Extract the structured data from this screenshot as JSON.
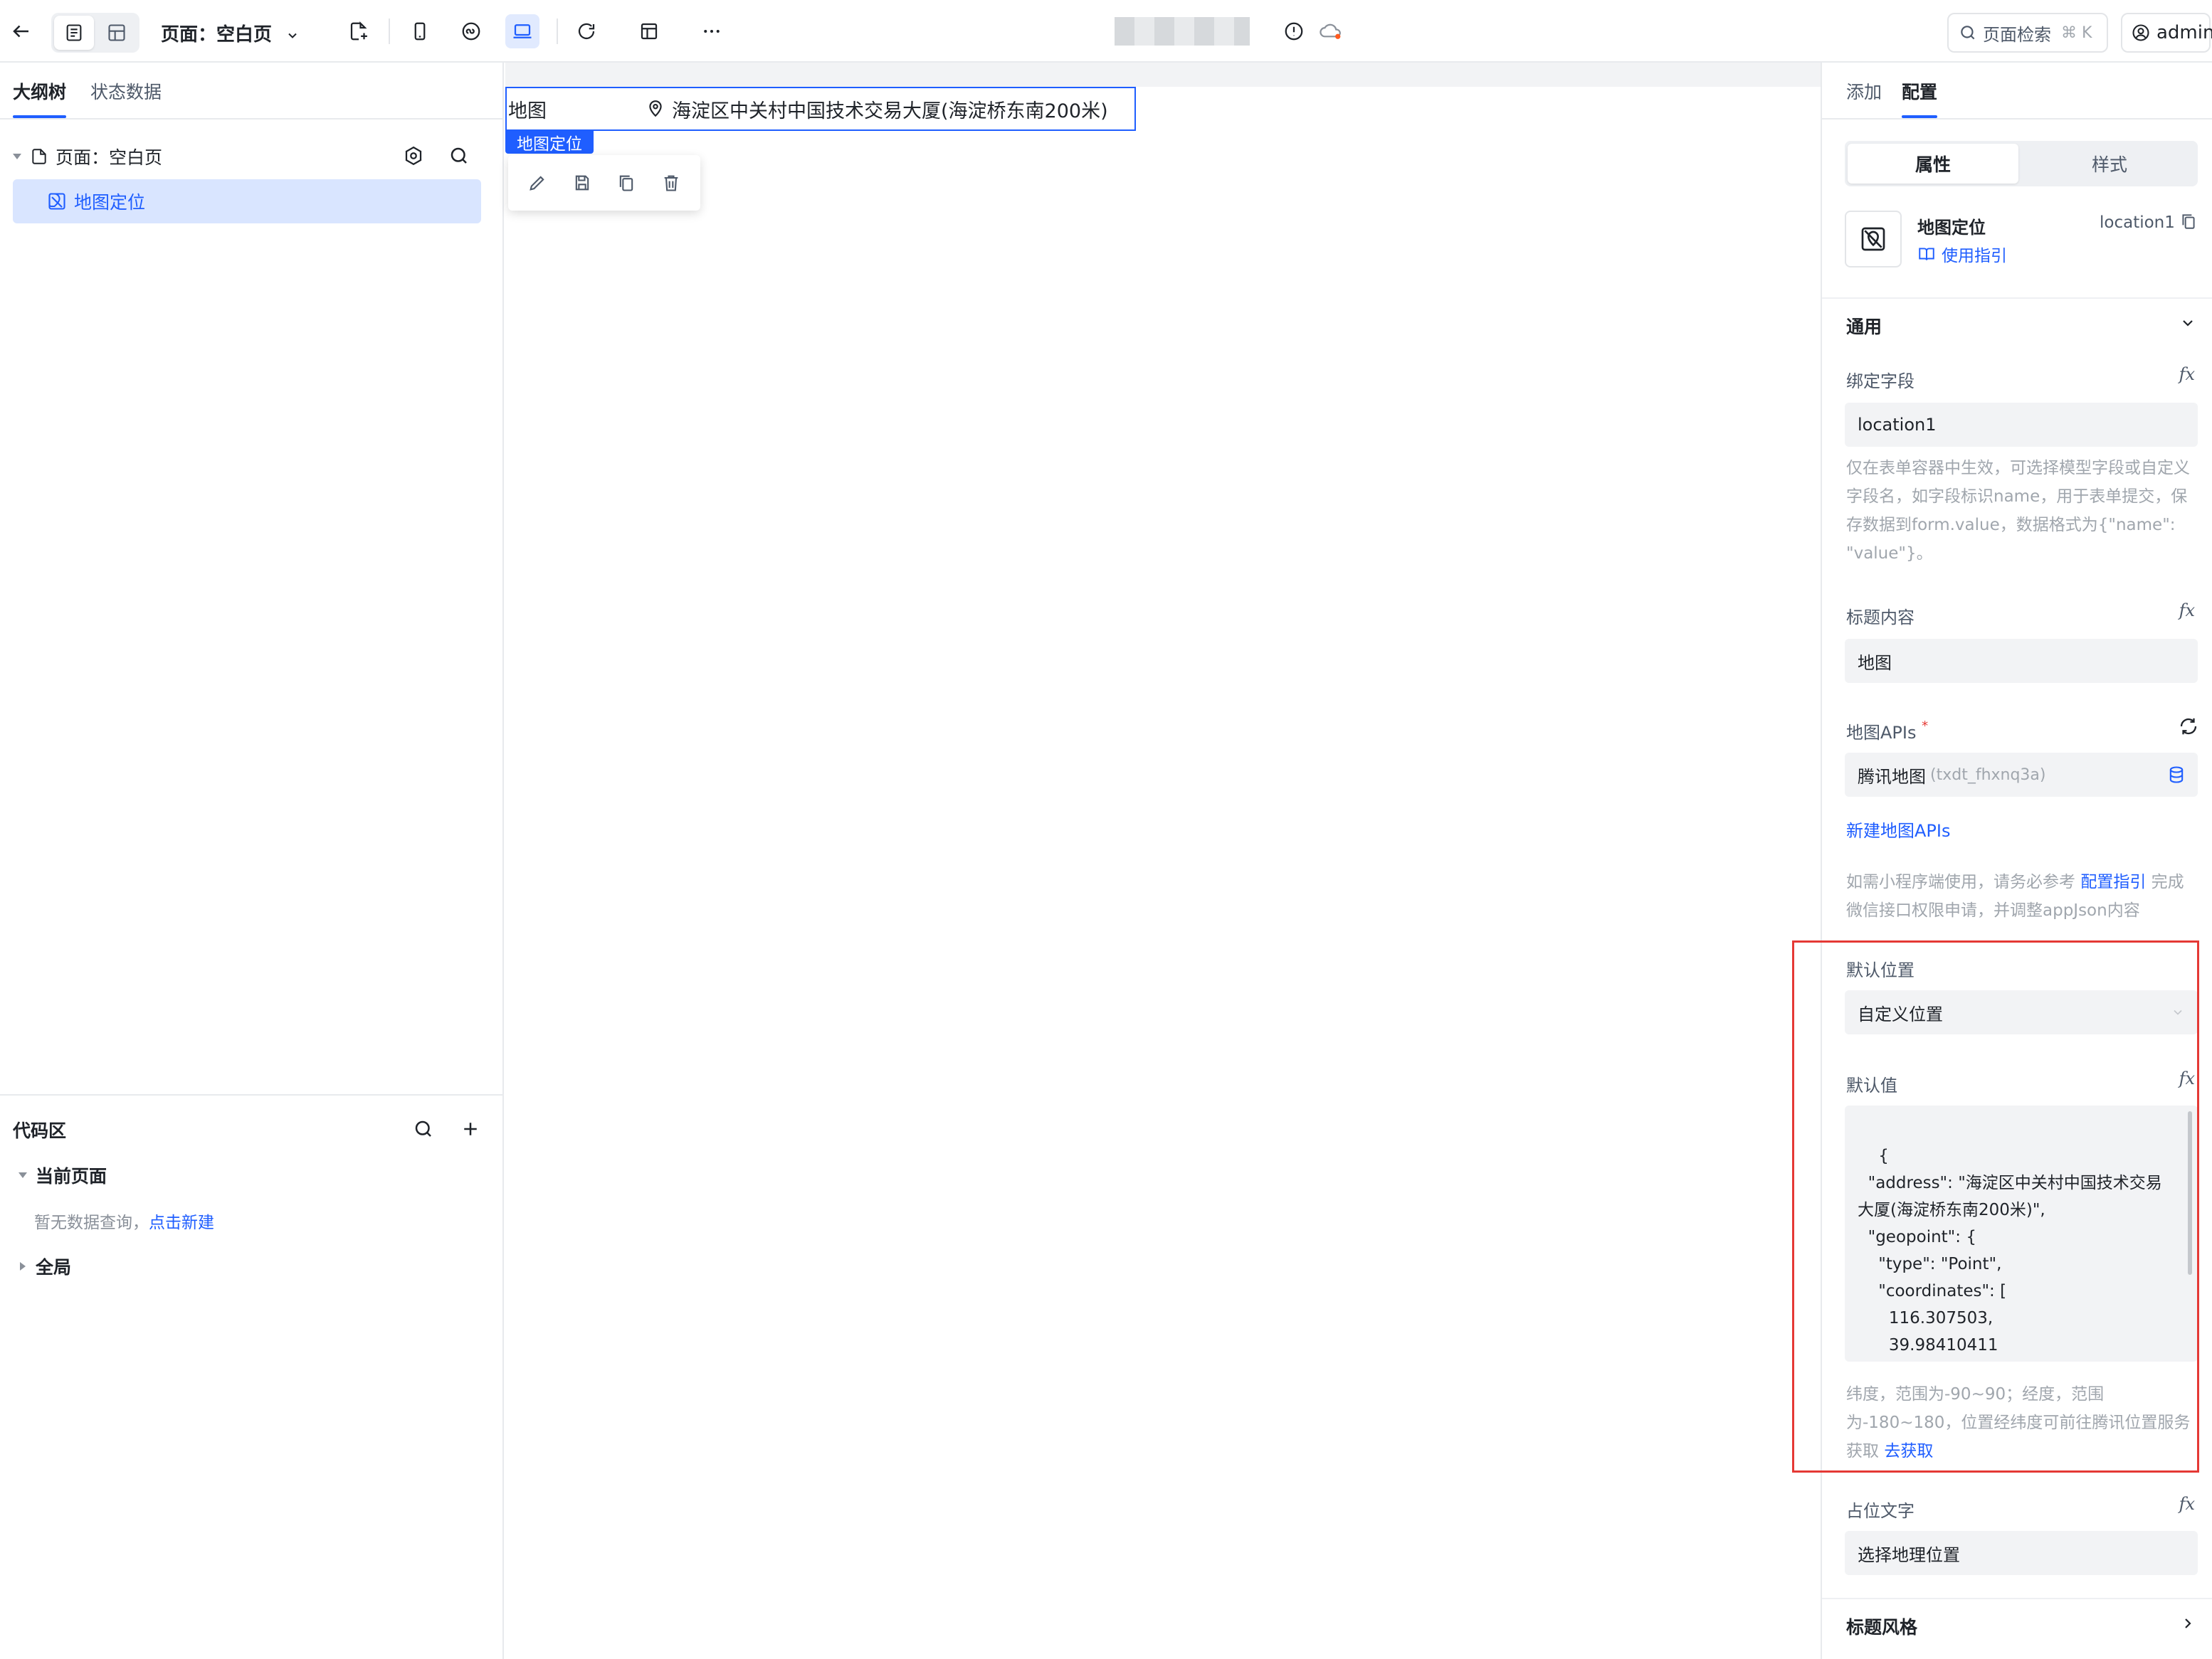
{
  "topbar": {
    "page_title": "页面：空白页",
    "search_label": "页面检索",
    "search_shortcut": "⌘ K",
    "user_name": "admin"
  },
  "left": {
    "tabs": [
      "大纲树",
      "状态数据"
    ],
    "tree": {
      "page_label": "页面：空白页",
      "selected_item": "地图定位"
    },
    "code": {
      "title": "代码区",
      "current_page": "当前页面",
      "empty_text": "暂无数据查询，",
      "create_link": "点击新建",
      "global": "全局"
    }
  },
  "canvas": {
    "map_label": "地图",
    "address": "海淀区中关村中国技术交易大厦(海淀桥东南200米)",
    "badge": "地图定位"
  },
  "right": {
    "tabs": [
      "添加",
      "配置"
    ],
    "segments": [
      "属性",
      "样式"
    ],
    "component": {
      "name": "地图定位",
      "id": "location1",
      "guide_link": "使用指引"
    },
    "general": {
      "title": "通用",
      "bind_field_label": "绑定字段",
      "bind_field_value": "location1",
      "bind_help": "仅在表单容器中生效，可选择模型字段或自定义字段名，如字段标识name，用于表单提交，保存数据到form.value，数据格式为{\"name\": \"value\"}。",
      "title_label": "标题内容",
      "title_value": "地图",
      "api_label": "地图APIs",
      "api_required": "*",
      "api_value": "腾讯地图",
      "api_id": "(txdt_fhxnq3a)",
      "new_api_link": "新建地图APIs",
      "mini_help_prefix": "如需小程序端使用，请务必参考",
      "mini_help_link": "配置指引",
      "mini_help_suffix": "完成微信接口权限申请，并调整appJson内容",
      "default_pos_label": "默认位置",
      "default_pos_value": "自定义位置",
      "default_value_label": "默认值",
      "default_value_json": "{\n  \"address\": \"海淀区中关村中国技术交易\n大厦(海淀桥东南200米)\",\n  \"geopoint\": {\n    \"type\": \"Point\",\n    \"coordinates\": [\n      116.307503,\n      39.98410411\n    ]",
      "coord_help": "纬度，范围为-90~90；经度，范围为-180~180，位置经纬度可前往腾讯位置服务获取",
      "coord_help_link": "去获取",
      "placeholder_label": "占位文字",
      "placeholder_value": "选择地理位置",
      "title_style": "标题风格",
      "fx_label": "fx"
    }
  },
  "colors": {
    "accent": "#1f5eff",
    "selected_bg": "#d9e5ff",
    "highlight_box": "#e53935"
  }
}
